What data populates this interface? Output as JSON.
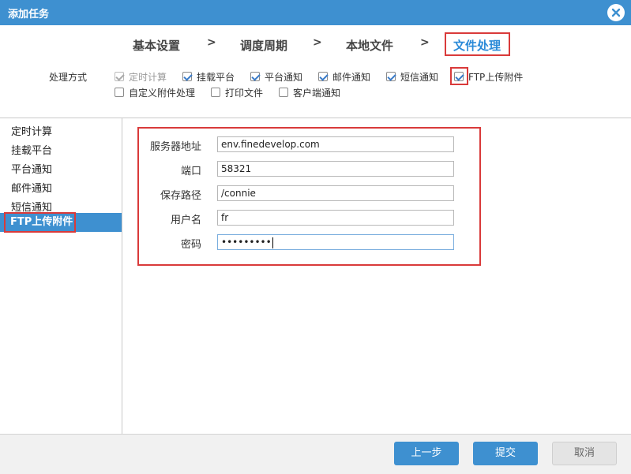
{
  "dialog": {
    "title": "添加任务",
    "close_icon": "close-icon"
  },
  "steps": [
    {
      "label": "基本设置"
    },
    {
      "label": "调度周期"
    },
    {
      "label": "本地文件"
    },
    {
      "label": "文件处理"
    }
  ],
  "step_separator": ">",
  "processing": {
    "label": "处理方式",
    "options": [
      {
        "label": "定时计算",
        "checked": true,
        "disabled": true
      },
      {
        "label": "挂载平台",
        "checked": true
      },
      {
        "label": "平台通知",
        "checked": true
      },
      {
        "label": "邮件通知",
        "checked": true
      },
      {
        "label": "短信通知",
        "checked": true
      },
      {
        "label": "FTP上传附件",
        "checked": true
      },
      {
        "label": "自定义附件处理",
        "checked": false
      },
      {
        "label": "打印文件",
        "checked": false
      },
      {
        "label": "客户端通知",
        "checked": false
      }
    ]
  },
  "sidebar": {
    "items": [
      {
        "label": "定时计算"
      },
      {
        "label": "挂载平台"
      },
      {
        "label": "平台通知"
      },
      {
        "label": "邮件通知"
      },
      {
        "label": "短信通知"
      },
      {
        "label": "FTP上传附件",
        "active": true
      }
    ]
  },
  "ftp_form": {
    "server": {
      "label": "服务器地址",
      "value": "env.finedevelop.com"
    },
    "port": {
      "label": "端口",
      "value": "58321"
    },
    "path": {
      "label": "保存路径",
      "value": "/connie"
    },
    "username": {
      "label": "用户名",
      "value": "fr"
    },
    "password": {
      "label": "密码",
      "value": "•••••••••"
    }
  },
  "buttons": {
    "prev": "上一步",
    "submit": "提交",
    "cancel": "取消"
  },
  "colors": {
    "accent": "#3e90d0",
    "highlight_border": "#d93a3a"
  }
}
